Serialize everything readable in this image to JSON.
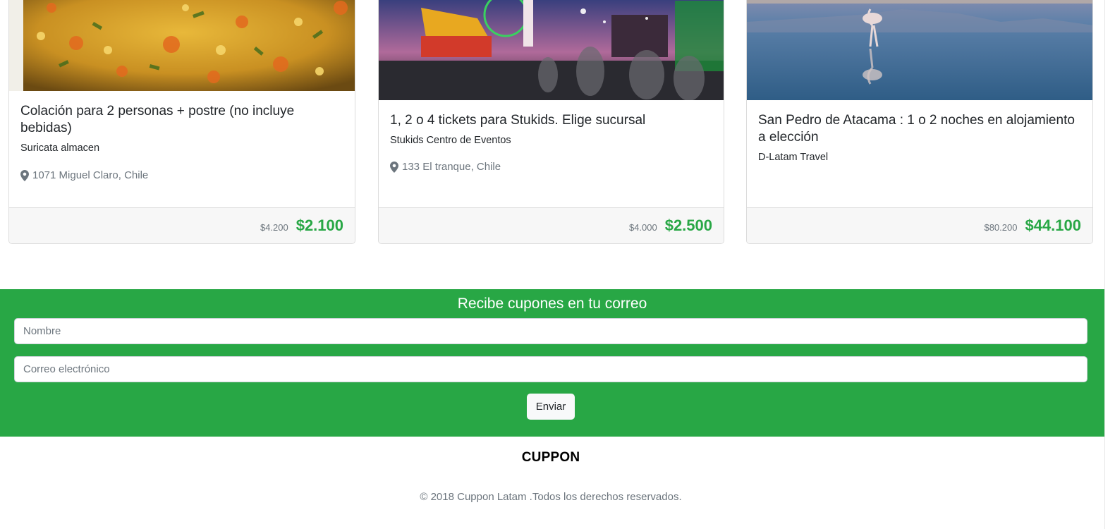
{
  "deals": [
    {
      "title": "Colación para 2 personas + postre (no incluye bebidas)",
      "merchant": "Suricata almacen",
      "location": "1071 Miguel Claro, Chile",
      "old_price": "$4.200",
      "price": "$2.100",
      "image_icon": "food-dish-photo"
    },
    {
      "title": "1, 2 o 4 tickets para Stukids. Elige sucursal",
      "merchant": "Stukids Centro de Eventos",
      "location": "133 El tranque, Chile",
      "old_price": "$4.000",
      "price": "$2.500",
      "image_icon": "amusement-fair-photo"
    },
    {
      "title": "San Pedro de Atacama : 1 o 2 noches en alojamiento a elección",
      "merchant": "D-Latam Travel",
      "old_price": "$80.200",
      "price": "$44.100",
      "image_icon": "flamingo-lake-photo"
    }
  ],
  "newsletter": {
    "title": "Recibe cupones en tu correo",
    "name_placeholder": "Nombre",
    "email_placeholder": "Correo electrónico",
    "submit_label": "Enviar"
  },
  "footer": {
    "brand": "CUPPON",
    "copyright": "© 2018 Cuppon Latam .Todos los derechos reservados."
  },
  "colors": {
    "accent": "#28a745",
    "muted": "#6c757d"
  }
}
